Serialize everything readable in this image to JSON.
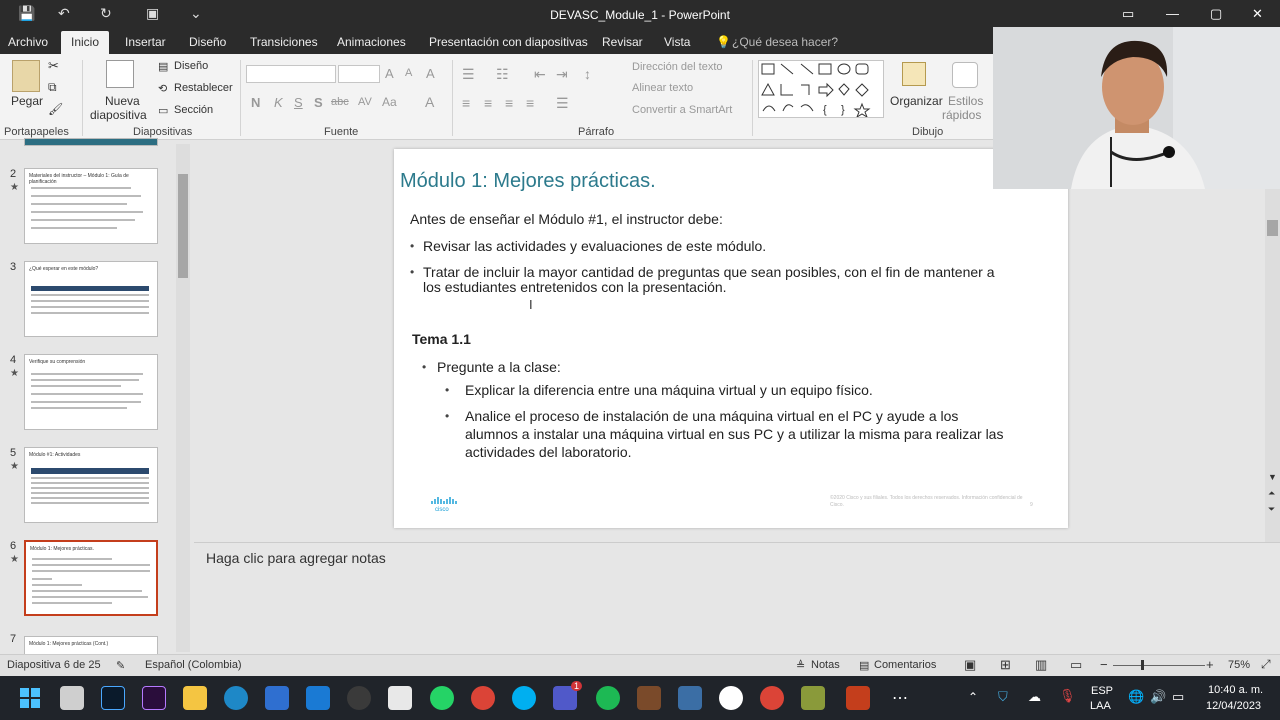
{
  "titlebar": {
    "title": "DEVASC_Module_1 - PowerPoint",
    "colors": {
      "bg": "#2b2b2b",
      "accent": "#c43e1c"
    }
  },
  "menu": {
    "tabs": [
      "Archivo",
      "Inicio",
      "Insertar",
      "Diseño",
      "Transiciones",
      "Animaciones",
      "Presentación con diapositivas",
      "Revisar",
      "Vista"
    ],
    "active": "Inicio",
    "search": "¿Qué desea hacer?"
  },
  "ribbon": {
    "portapapeles": {
      "paste": "Pegar",
      "label": "Portapapeles"
    },
    "diapositivas": {
      "new_slide_1": "Nueva",
      "new_slide_2": "diapositiva",
      "layout": "Diseño",
      "reset": "Restablecer",
      "section": "Sección",
      "label": "Diapositivas"
    },
    "fuente": {
      "bold": "N",
      "italic": "K",
      "underline": "S",
      "shadow": "S",
      "strike": "abc",
      "spacing": "AV",
      "case": "Aa",
      "color": "A",
      "grow": "A",
      "shrink": "A",
      "clear": "A",
      "label": "Fuente"
    },
    "parrafo": {
      "direction": "Dirección del texto",
      "align": "Alinear texto",
      "smartart": "Convertir a SmartArt",
      "label": "Párrafo"
    },
    "dibujo": {
      "arrange": "Organizar",
      "styles_1": "Estilos",
      "styles_2": "rápidos",
      "label": "Dibujo"
    }
  },
  "thumbnails": [
    {
      "num": "2",
      "star": "★",
      "title": "Materiales del instructor – Módulo 1: Guía de planificación"
    },
    {
      "num": "3",
      "star": "",
      "title": "¿Qué esperar en este módulo?"
    },
    {
      "num": "4",
      "star": "★",
      "title": "Verifique su comprensión"
    },
    {
      "num": "5",
      "star": "★",
      "title": "Módulo #1: Actividades"
    },
    {
      "num": "6",
      "star": "★",
      "title": "Módulo 1: Mejores prácticas."
    },
    {
      "num": "7",
      "star": "",
      "title": "Módulo 1: Mejores prácticas (Cont.)"
    }
  ],
  "slide": {
    "title": "Módulo 1: Mejores prácticas.",
    "intro": "Antes de enseñar el Módulo #1, el instructor debe:",
    "b1": "Revisar las actividades y evaluaciones de este módulo.",
    "b2_l1": "Tratar de incluir la mayor cantidad de preguntas que sean posibles, con el fin de mantener a",
    "b2_l2": "los estudiantes entretenidos con la presentación.",
    "topic": "Tema 1.1",
    "ask": "Pregunte a la clase:",
    "q1": "Explicar la diferencia entre una máquina virtual y un equipo físico.",
    "q2_l1": "Analice el proceso de instalación de una máquina virtual en el PC y ayude a los",
    "q2_l2": "alumnos a instalar una máquina virtual en sus PC y a utilizar la misma para realizar las",
    "q2_l3": "actividades del laboratorio.",
    "logo": "cisco",
    "copyright": "©2020 Cisco y sus filiales. Todos los derechos reservados. Información confidencial de Cisco.",
    "page": "9",
    "title_color": "#2c7a8c"
  },
  "notes": {
    "placeholder": "Haga clic para agregar notas"
  },
  "status": {
    "slide_info": "Diapositiva 6 de 25",
    "language": "Español (Colombia)",
    "notes": "Notas",
    "comments": "Comentarios",
    "zoom": "75%"
  },
  "taskbar": {
    "lang_1": "ESP",
    "lang_2": "LAA",
    "time": "10:40 a. m.",
    "date": "12/04/2023",
    "badge": "1"
  }
}
